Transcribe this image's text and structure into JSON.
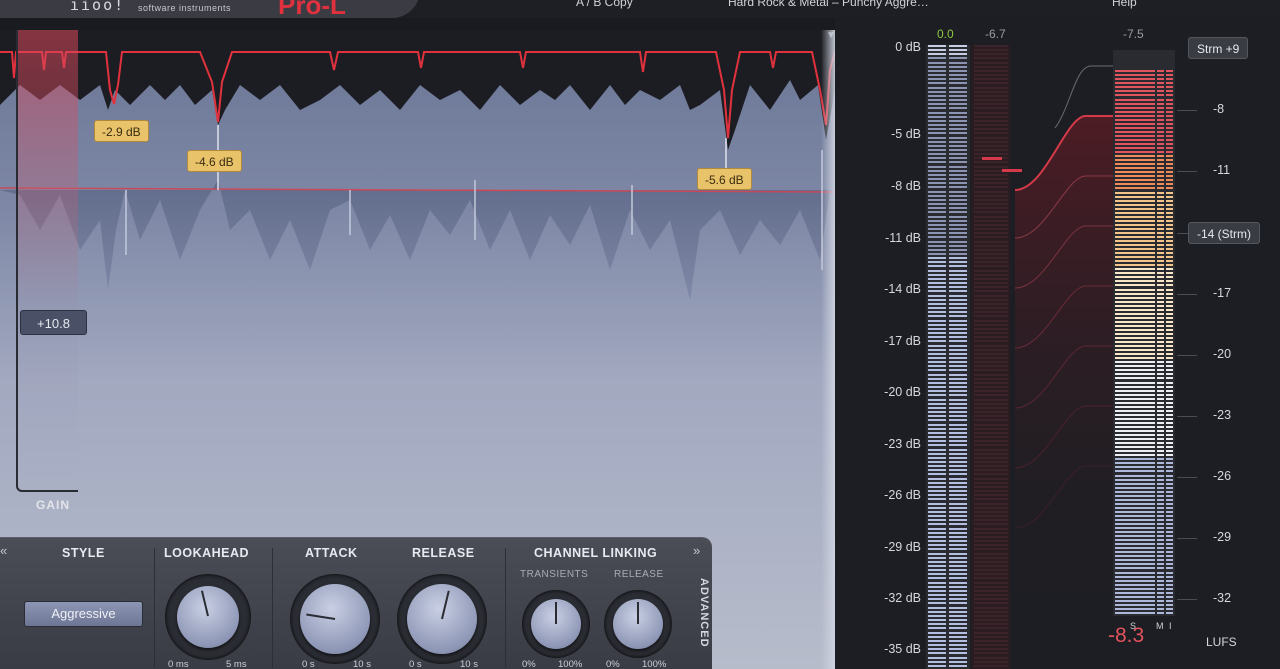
{
  "topbar": {
    "brand_mark": "ıioo!",
    "brand_sub": "software instruments",
    "product": "Pro-L",
    "copy_label": "A / B   Copy",
    "preset": "Hard Rock & Metal – Punchy Aggre…",
    "help": "Help"
  },
  "display": {
    "gain_label": "GAIN",
    "gain_value": "+10.8",
    "peak_tags": [
      "-2.9 dB",
      "-4.6 dB",
      "-5.6 dB"
    ]
  },
  "panel": {
    "style_label": "STYLE",
    "style_value": "Aggressive",
    "lookahead_label": "LOOKAHEAD",
    "lookahead_min": "0 ms",
    "lookahead_max": "5 ms",
    "attack_label": "ATTACK",
    "attack_min": "0 s",
    "attack_max": "10 s",
    "release_label": "RELEASE",
    "release_min": "0 s",
    "release_max": "10 s",
    "channel_linking_label": "CHANNEL LINKING",
    "transients_label": "TRANSIENTS",
    "cl_release_label": "RELEASE",
    "pct_min": "0%",
    "pct_max": "100%",
    "advanced_label": "ADVANCED",
    "expand_left": "«",
    "expand_right": "»"
  },
  "levels": {
    "lookahead": 0.45,
    "attack": 0.2,
    "release": 0.55,
    "transients": 0.5,
    "cl_release": 0.5
  },
  "meters": {
    "db_scale": [
      "0 dB",
      "-5 dB",
      "-8 dB",
      "-11 dB",
      "-14 dB",
      "-17 dB",
      "-20 dB",
      "-23 dB",
      "-26 dB",
      "-29 dB",
      "-32 dB",
      "-35 dB"
    ],
    "peak_left": "0.0",
    "peak_right": "-6.7",
    "loud_peak": "-7.5",
    "lufs_scale": [
      "-8",
      "-11",
      "-14",
      "-17",
      "-20",
      "-23",
      "-26",
      "-29",
      "-32"
    ],
    "tag_top": "Strm +9",
    "tag_target": "-14 (Strm)",
    "s_label": "S",
    "m_label": "M",
    "i_label": "I",
    "lufs_value": "-8.3",
    "lufs_unit": "LUFS",
    "dropdown_arrow": "▼"
  },
  "colors": {
    "accent_red": "#e0323e",
    "peak_green": "#8cc63f",
    "tag_yellow": "#e8c36a"
  }
}
